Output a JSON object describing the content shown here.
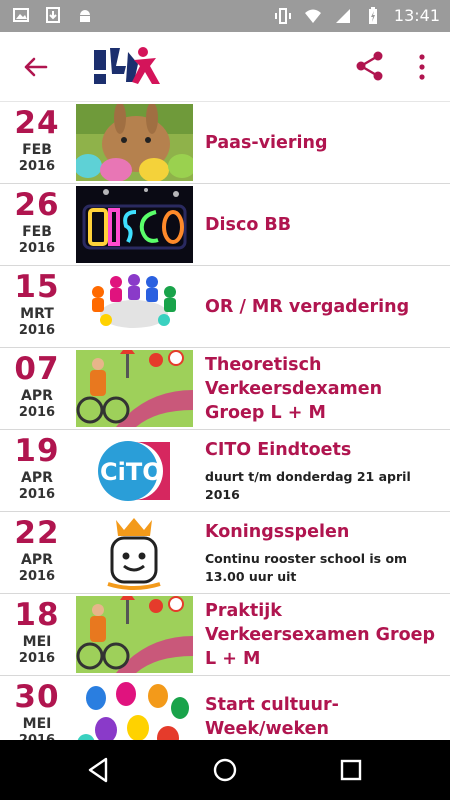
{
  "statusbar": {
    "time": "13:41",
    "left_icons": [
      "image-icon",
      "download-icon",
      "android-icon"
    ],
    "right_icons": [
      "vibrate-icon",
      "wifi-icon",
      "signal-icon",
      "battery-charging-icon"
    ]
  },
  "appbar": {
    "back_icon": "arrow-left-icon",
    "logo": "school-logo",
    "share_icon": "share-icon",
    "more_icon": "more-vert-icon"
  },
  "colors": {
    "accent": "#b0154f",
    "text": "#333333",
    "divider": "#d8d8d8"
  },
  "events": [
    {
      "day": "24",
      "month": "FEB",
      "year": "2016",
      "title": "Paas-viering",
      "subtitle": "",
      "image": "easter-bunny-image"
    },
    {
      "day": "26",
      "month": "FEB",
      "year": "2016",
      "title": "Disco BB",
      "subtitle": "",
      "image": "disco-sign-image"
    },
    {
      "day": "15",
      "month": "MRT",
      "year": "2016",
      "title": "OR / MR vergadering",
      "subtitle": "",
      "image": "meeting-table-image"
    },
    {
      "day": "07",
      "month": "APR",
      "year": "2016",
      "title": "Theoretisch Verkeersdexamen Groep L + M",
      "subtitle": "",
      "image": "traffic-cyclist-image"
    },
    {
      "day": "19",
      "month": "APR",
      "year": "2016",
      "title": "CITO Eindtoets",
      "subtitle": "duurt t/m donderdag 21 april 2016",
      "image": "cito-logo-image"
    },
    {
      "day": "22",
      "month": "APR",
      "year": "2016",
      "title": "Koningsspelen",
      "subtitle": "Continu rooster school is om 13.00 uur uit",
      "image": "koningsspelen-logo-image"
    },
    {
      "day": "18",
      "month": "MEI",
      "year": "2016",
      "title": "Praktijk Verkeersexamen Groep L + M",
      "subtitle": "",
      "image": "traffic-cyclist-image"
    },
    {
      "day": "30",
      "month": "MEI",
      "year": "2016",
      "title": "Start cultuur-Week/weken",
      "subtitle": "",
      "image": "painted-hands-image"
    }
  ],
  "navbar": {
    "back_icon": "nav-back-icon",
    "home_icon": "nav-home-icon",
    "recents_icon": "nav-recents-icon"
  }
}
